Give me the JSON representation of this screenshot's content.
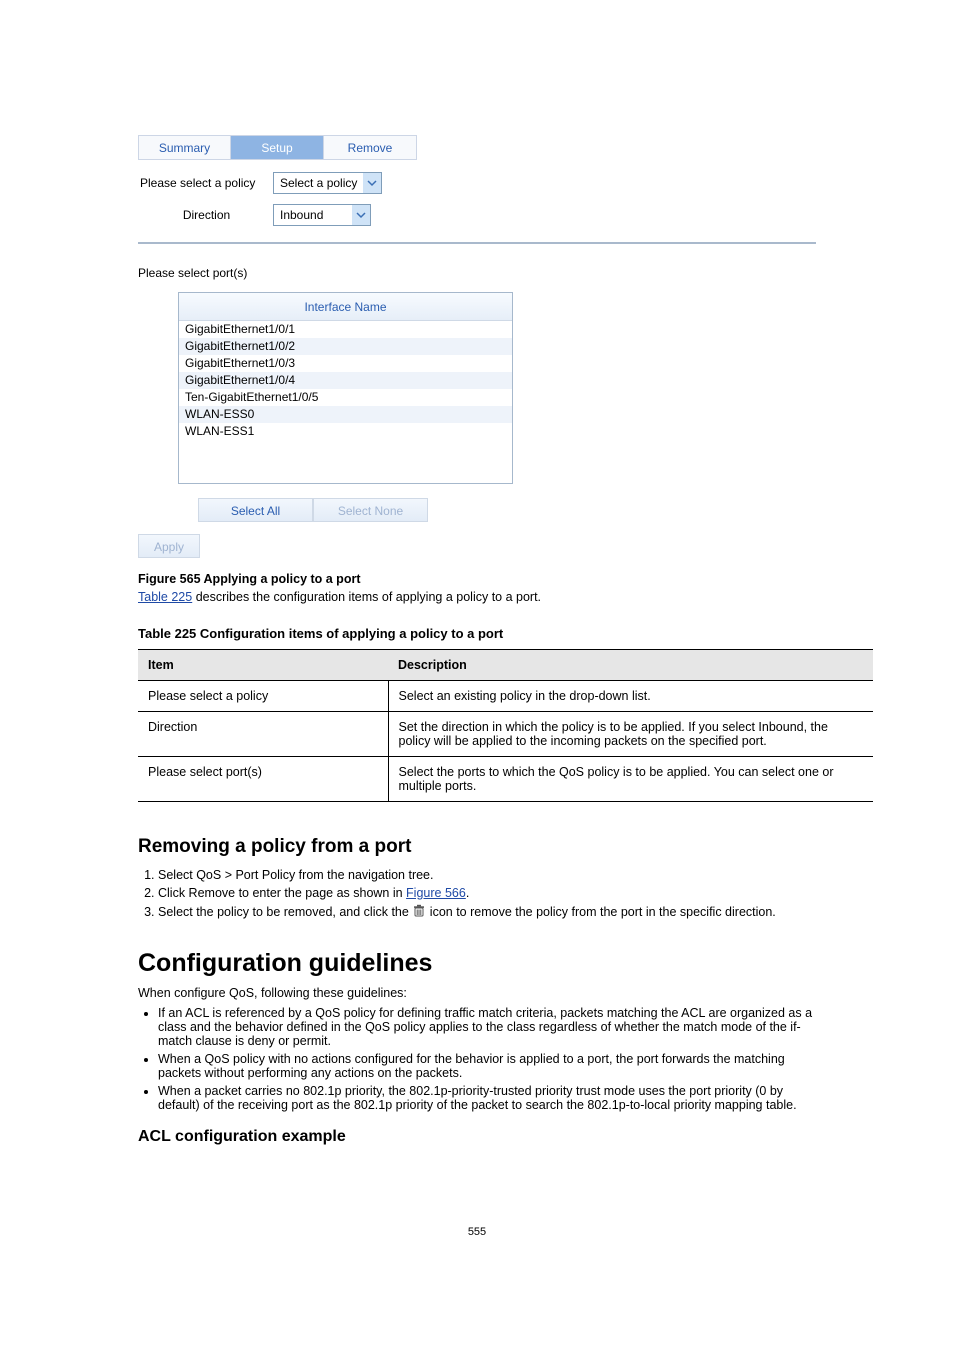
{
  "ui": {
    "tabs": {
      "summary": "Summary",
      "setup": "Setup",
      "remove": "Remove"
    },
    "policyLabel": "Please select a policy",
    "policySelect": "Select a policy",
    "directionLabel": "Direction",
    "directionSelect": "Inbound",
    "portsLabel": "Please select port(s)",
    "portsHeader": "Interface Name",
    "ports": [
      "GigabitEthernet1/0/1",
      "GigabitEthernet1/0/2",
      "GigabitEthernet1/0/3",
      "GigabitEthernet1/0/4",
      "Ten-GigabitEthernet1/0/5",
      "WLAN-ESS0",
      "WLAN-ESS1"
    ],
    "selectAll": "Select All",
    "selectNone": "Select None",
    "apply": "Apply"
  },
  "caption": "Figure 565 Applying a policy to a port",
  "afterTableText1": " describes the configuration items of applying a policy to a port.",
  "tableLinkText": "Table 225",
  "tableCaption": "Table 225 Configuration items of applying a policy to a port",
  "table": {
    "h1": "Item",
    "h2": "Description",
    "r1c1": "Please select a policy",
    "r1c2": "Select an existing policy in the drop-down list.",
    "r2c1": "Direction",
    "r2c2": "Set the direction in which the policy is to be applied. If you select Inbound, the policy will be applied to the incoming packets on the specified port.",
    "r3c1": "Please select port(s)",
    "r3c2": "Select the ports to which the QoS policy is to be applied. You can select one or multiple ports."
  },
  "removeH2": "Removing a policy from a port",
  "removeStep1": "Select QoS > Port Policy from the navigation tree.",
  "removeStep2A": "Click Remove to enter the page as shown in ",
  "removeStep2Link": "Figure 566",
  "removeStep2B": ".",
  "removeStep3A": "Select the policy to be removed, and click the ",
  "removeStep3B": " icon to remove the policy from the port in the specific direction.",
  "h1": "Configuration guidelines",
  "guideIntro": "When configure QoS, following these guidelines:",
  "g1": "If an ACL is referenced by a QoS policy for defining traffic match criteria, packets matching the ACL are organized as a class and the behavior defined in the QoS policy applies to the class regardless of whether the match mode of the if-match clause is deny or permit.",
  "g2": "When a QoS policy with no actions configured for the behavior is applied to a port, the port forwards the matching packets without performing any actions on the packets.",
  "g3": "When a packet carries no 802.1p priority, the 802.1p-priority-trusted priority trust mode uses the port priority (0 by default) of the receiving port as the 802.1p priority of the packet to search the 802.1p-to-local priority mapping table.",
  "h3": "ACL configuration example",
  "pageNum": "555"
}
